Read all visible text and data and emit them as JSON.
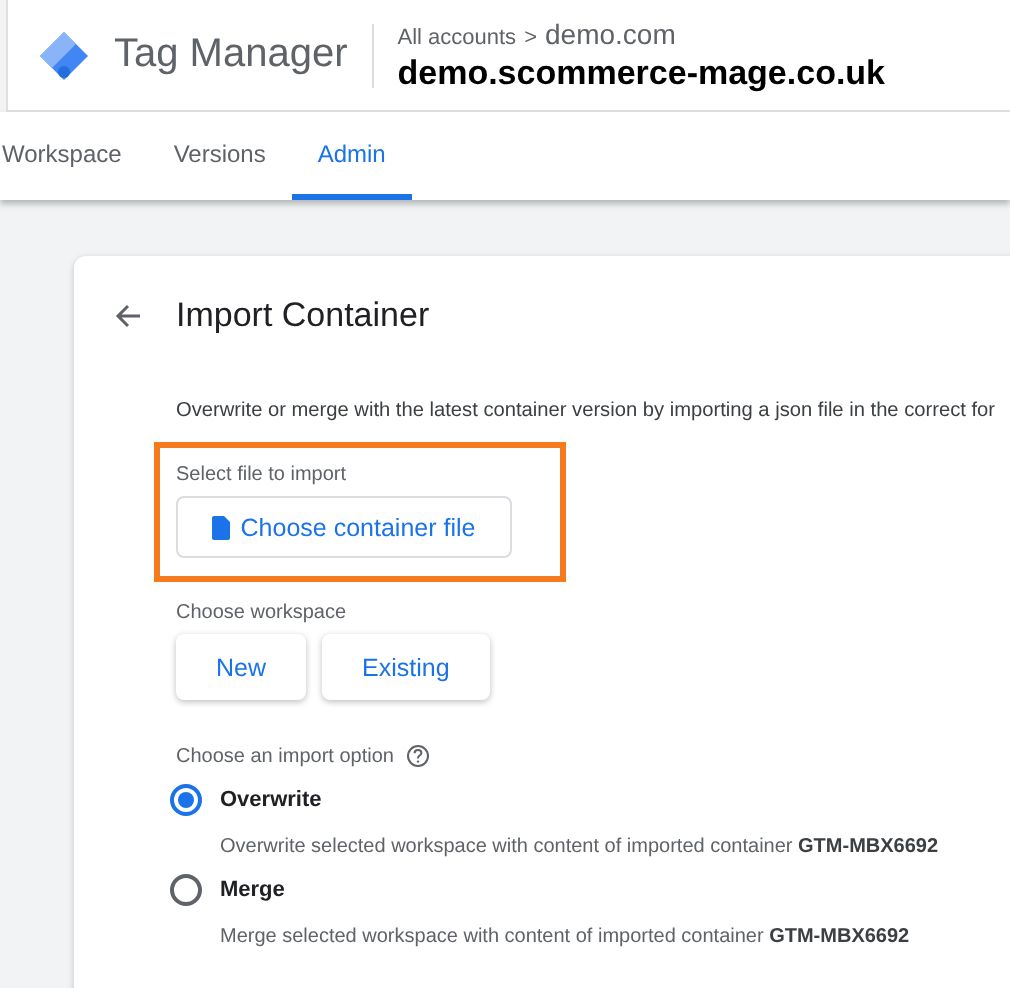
{
  "header": {
    "product": "Tag Manager",
    "breadcrumb_root": "All accounts",
    "breadcrumb_separator": ">",
    "account": "demo.com",
    "container_name": "demo.scommerce-mage.co.uk"
  },
  "tabs": [
    {
      "label": "Workspace",
      "selected": false
    },
    {
      "label": "Versions",
      "selected": false
    },
    {
      "label": "Admin",
      "selected": true
    }
  ],
  "page": {
    "title": "Import Container",
    "description": "Overwrite or merge with the latest container version by importing a json file in the correct for",
    "file_section": {
      "label": "Select file to import",
      "button": "Choose container file"
    },
    "workspace_section": {
      "label": "Choose workspace",
      "buttons": [
        "New",
        "Existing"
      ]
    },
    "import_option": {
      "label": "Choose an import option",
      "options": [
        {
          "label": "Overwrite",
          "description": "Overwrite selected workspace with content of imported container **GTM-MBX6692**",
          "selected": true
        },
        {
          "label": "Merge",
          "description": "Merge selected workspace with content of imported container **GTM-MBX6692**",
          "selected": false
        }
      ]
    }
  }
}
